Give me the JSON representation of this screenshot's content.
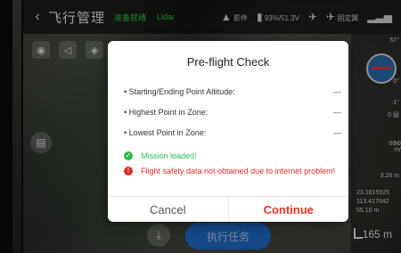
{
  "topbar": {
    "title": "飞行管理",
    "status": "准备就绪",
    "payload": "Lidar",
    "mode": "影件",
    "battery": "93%/51.3V",
    "setting": "固定翼",
    "back_icon": "chevron-left-icon"
  },
  "right_panel": {
    "values": [
      "57°",
      "0°",
      "-1°",
      "0 级",
      "0 m",
      "0.0 m/",
      "3.26 m"
    ],
    "coords": [
      "23.1815925",
      "113.417042",
      "55.10 m"
    ]
  },
  "map": {
    "scale": "165 m",
    "start_button": "执行任务"
  },
  "dialog": {
    "title": "Pre-flight Check",
    "rows": [
      {
        "label": "Starting/Ending Point Altitude:",
        "value": "—"
      },
      {
        "label": "Highest Point in Zone:",
        "value": "—"
      },
      {
        "label": "Lowest Point in Zone:",
        "value": "—"
      }
    ],
    "success_msg": "Mission loaded!",
    "error_msg": "Flight safety data not obtained due to internet problem!",
    "cancel_label": "Cancel",
    "continue_label": "Continue"
  },
  "colors": {
    "success": "#2ebc4e",
    "error": "#e02a2a",
    "continue": "#e3372a",
    "primary": "#1f6fd1"
  }
}
